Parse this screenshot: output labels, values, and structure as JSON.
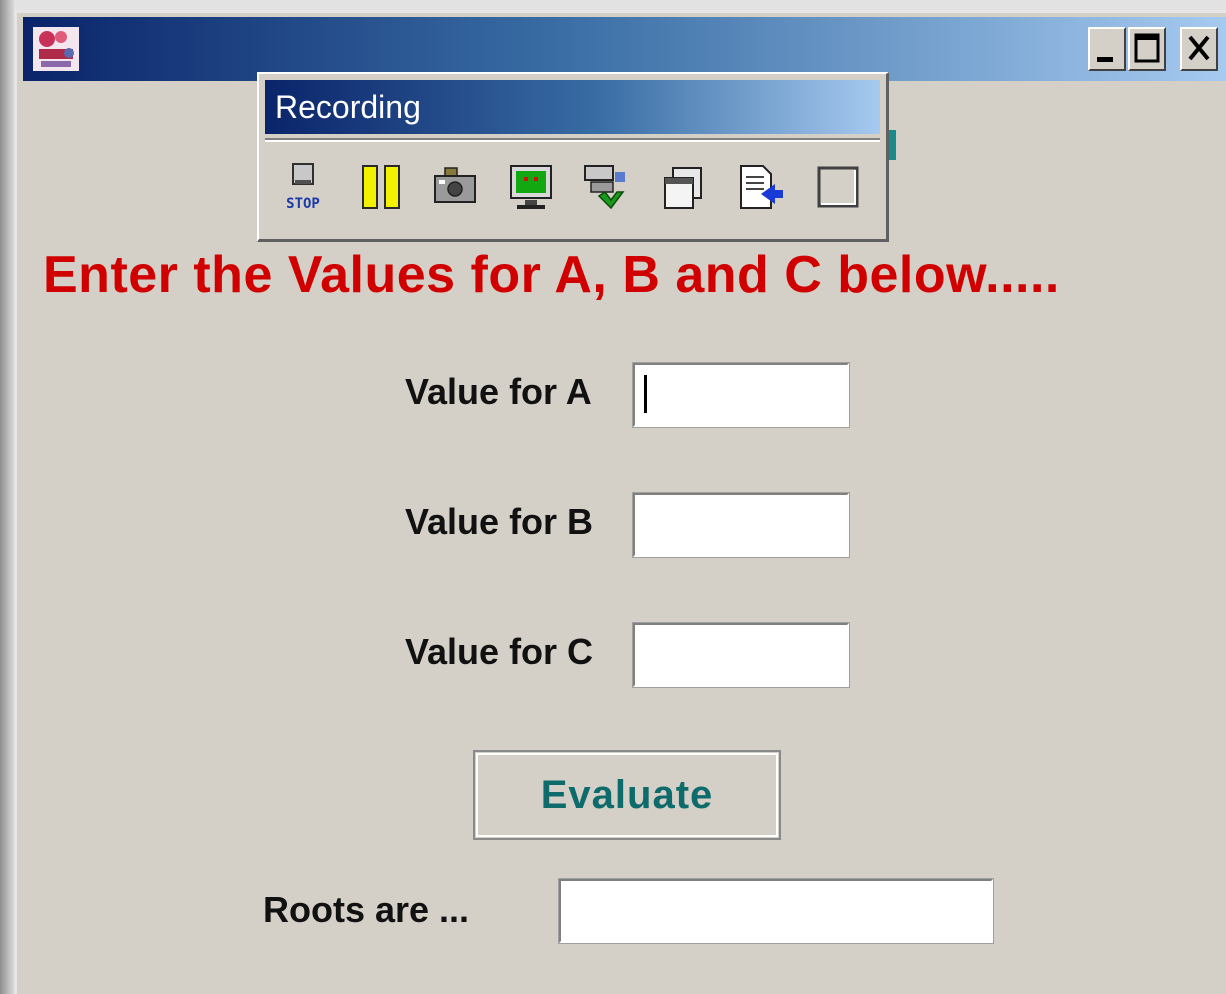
{
  "window": {
    "app_icon": "java-app-icon",
    "controls": {
      "minimize": "minimize-icon",
      "maximize": "maximize-icon",
      "close": "close-icon"
    }
  },
  "recording_toolbar": {
    "title": "Recording",
    "stop_label": "STOP",
    "tools": [
      "stop-icon",
      "pause-icon",
      "camera-icon",
      "monitor-icon",
      "object-spy-icon",
      "windows-icon",
      "insert-file-icon",
      "checkbox-icon"
    ]
  },
  "form": {
    "heading": "Enter the Values for A, B and C below.....",
    "fields": [
      {
        "label": "Value for A",
        "value": ""
      },
      {
        "label": "Value for B",
        "value": ""
      },
      {
        "label": "Value for C",
        "value": ""
      }
    ],
    "evaluate_label": "Evaluate",
    "roots_label": "Roots are ...",
    "roots_value": ""
  },
  "colors": {
    "heading": "#d10000",
    "button_text": "#0e6b6b",
    "titlebar_start": "#0a246a",
    "titlebar_end": "#a6caf0",
    "window_bg": "#d4d0c8"
  }
}
